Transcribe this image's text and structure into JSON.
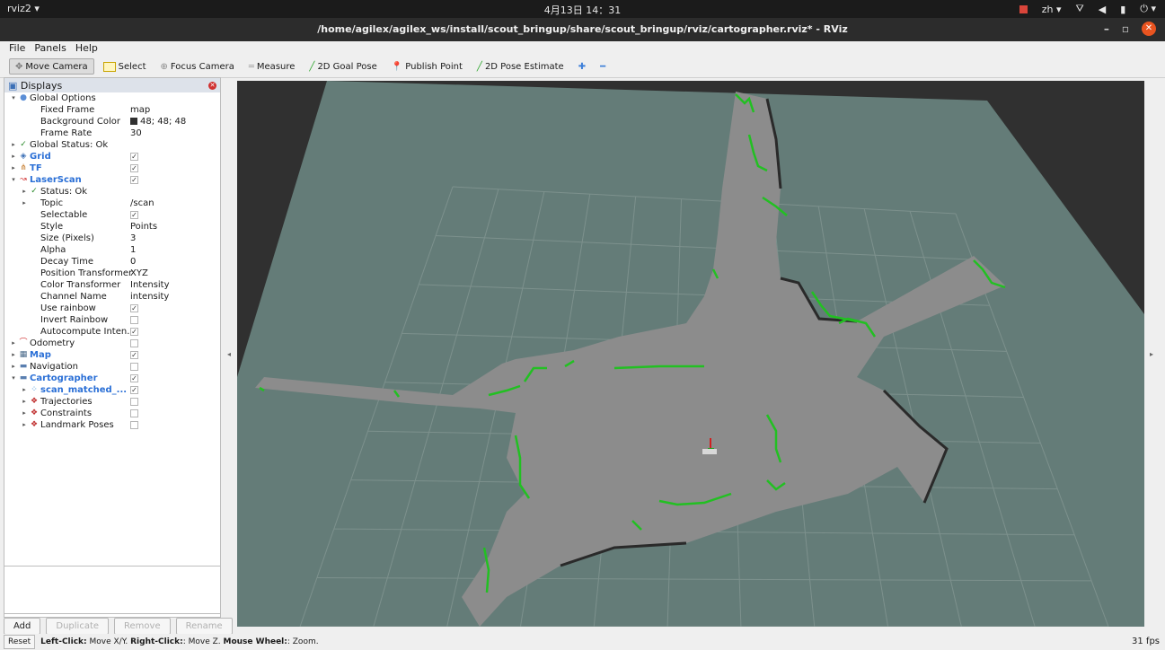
{
  "topbar": {
    "app": "rviz2 ▾",
    "clock": "4月13日 14：31",
    "lang": "zh ▾"
  },
  "window": {
    "title": "/home/agilex/agilex_ws/install/scout_bringup/share/scout_bringup/rviz/cartographer.rviz* - RViz"
  },
  "menu": {
    "file": "File",
    "panels": "Panels",
    "help": "Help"
  },
  "toolbar": {
    "move_camera": "Move Camera",
    "select": "Select",
    "focus_camera": "Focus Camera",
    "measure": "Measure",
    "goal_pose": "2D Goal Pose",
    "publish_point": "Publish Point",
    "pose_estimate": "2D Pose Estimate"
  },
  "displays": {
    "title": "Displays",
    "rows": [
      {
        "arrow": "▾",
        "icon": "●",
        "icon_color": "#5b8ed6",
        "name": "Global Options",
        "value": "",
        "check": "",
        "blue": false,
        "level": 0
      },
      {
        "arrow": "",
        "icon": "",
        "name": "Fixed Frame",
        "value": "map",
        "check": "",
        "blue": false,
        "level": 1
      },
      {
        "arrow": "",
        "icon": "",
        "name": "Background Color",
        "value": "48; 48; 48",
        "swatch": true,
        "check": "",
        "blue": false,
        "level": 1
      },
      {
        "arrow": "",
        "icon": "",
        "name": "Frame Rate",
        "value": "30",
        "check": "",
        "blue": false,
        "level": 1
      },
      {
        "arrow": "▸",
        "icon": "✓",
        "icon_color": "#2a8a2a",
        "name": "Global Status: Ok",
        "value": "",
        "check": "",
        "blue": false,
        "level": 0
      },
      {
        "arrow": "▸",
        "icon": "◈",
        "icon_color": "#3b6fb6",
        "name": "Grid",
        "value": "",
        "check": "✓",
        "blue": true,
        "level": 0
      },
      {
        "arrow": "▸",
        "icon": "⋔",
        "icon_color": "#c47a2a",
        "name": "TF",
        "value": "",
        "check": "✓",
        "blue": true,
        "level": 0
      },
      {
        "arrow": "▾",
        "icon": "↝",
        "icon_color": "#d03030",
        "name": "LaserScan",
        "value": "",
        "check": "✓",
        "blue": true,
        "level": 0
      },
      {
        "arrow": "▸",
        "icon": "✓",
        "icon_color": "#2a8a2a",
        "name": "Status: Ok",
        "value": "",
        "check": "",
        "blue": false,
        "level": 1
      },
      {
        "arrow": "▸",
        "icon": "",
        "name": "Topic",
        "value": "/scan",
        "check": "",
        "blue": false,
        "level": 1
      },
      {
        "arrow": "",
        "icon": "",
        "name": "Selectable",
        "value": "",
        "check": "✓",
        "blue": false,
        "level": 1
      },
      {
        "arrow": "",
        "icon": "",
        "name": "Style",
        "value": "Points",
        "check": "",
        "blue": false,
        "level": 1
      },
      {
        "arrow": "",
        "icon": "",
        "name": "Size (Pixels)",
        "value": "3",
        "check": "",
        "blue": false,
        "level": 1
      },
      {
        "arrow": "",
        "icon": "",
        "name": "Alpha",
        "value": "1",
        "check": "",
        "blue": false,
        "level": 1
      },
      {
        "arrow": "",
        "icon": "",
        "name": "Decay Time",
        "value": "0",
        "check": "",
        "blue": false,
        "level": 1
      },
      {
        "arrow": "",
        "icon": "",
        "name": "Position Transformer",
        "value": "XYZ",
        "check": "",
        "blue": false,
        "level": 1
      },
      {
        "arrow": "",
        "icon": "",
        "name": "Color Transformer",
        "value": "Intensity",
        "check": "",
        "blue": false,
        "level": 1
      },
      {
        "arrow": "",
        "icon": "",
        "name": "Channel Name",
        "value": "intensity",
        "check": "",
        "blue": false,
        "level": 1
      },
      {
        "arrow": "",
        "icon": "",
        "name": "Use rainbow",
        "value": "",
        "check": "✓",
        "blue": false,
        "level": 1
      },
      {
        "arrow": "",
        "icon": "",
        "name": "Invert Rainbow",
        "value": "",
        "check": " ",
        "blue": false,
        "level": 1
      },
      {
        "arrow": "",
        "icon": "",
        "name": "Autocompute Inten...",
        "value": "",
        "check": "✓",
        "blue": false,
        "level": 1
      },
      {
        "arrow": "▸",
        "icon": "⌒",
        "icon_color": "#d03030",
        "name": "Odometry",
        "value": "",
        "check": " ",
        "blue": false,
        "level": 0
      },
      {
        "arrow": "▸",
        "icon": "▦",
        "icon_color": "#4a6a8a",
        "name": "Map",
        "value": "",
        "check": "✓",
        "blue": true,
        "level": 0
      },
      {
        "arrow": "▸",
        "icon": "▬",
        "icon_color": "#5a7fb0",
        "name": "Navigation",
        "value": "",
        "check": " ",
        "blue": false,
        "level": 0
      },
      {
        "arrow": "▾",
        "icon": "▬",
        "icon_color": "#5a7fb0",
        "name": "Cartographer",
        "value": "",
        "check": "✓",
        "blue": true,
        "level": 0
      },
      {
        "arrow": "▸",
        "icon": "⁘",
        "icon_color": "#3b8fd6",
        "name": "scan_matched_...",
        "value": "",
        "check": "✓",
        "blue": true,
        "level": 1
      },
      {
        "arrow": "▸",
        "icon": "❖",
        "icon_color": "#c03030",
        "name": "Trajectories",
        "value": "",
        "check": " ",
        "blue": false,
        "level": 1
      },
      {
        "arrow": "▸",
        "icon": "❖",
        "icon_color": "#c03030",
        "name": "Constraints",
        "value": "",
        "check": " ",
        "blue": false,
        "level": 1
      },
      {
        "arrow": "▸",
        "icon": "❖",
        "icon_color": "#c03030",
        "name": "Landmark Poses",
        "value": "",
        "check": " ",
        "blue": false,
        "level": 1
      }
    ]
  },
  "buttons": {
    "add": "Add",
    "duplicate": "Duplicate",
    "remove": "Remove",
    "rename": "Rename"
  },
  "status": {
    "reset": "Reset",
    "hint_lc": "Left-Click:",
    "hint_lc_t": " Move X/Y. ",
    "hint_rc": "Right-Click:",
    "hint_rc_t": ": Move Z. ",
    "hint_mw": "Mouse Wheel:",
    "hint_mw_t": ": Zoom.",
    "fps": "31 fps"
  },
  "colors": {
    "view_bg": "#303030",
    "ground": "#647c78",
    "free_space": "#8c8c8c",
    "scan": "#22c022"
  }
}
